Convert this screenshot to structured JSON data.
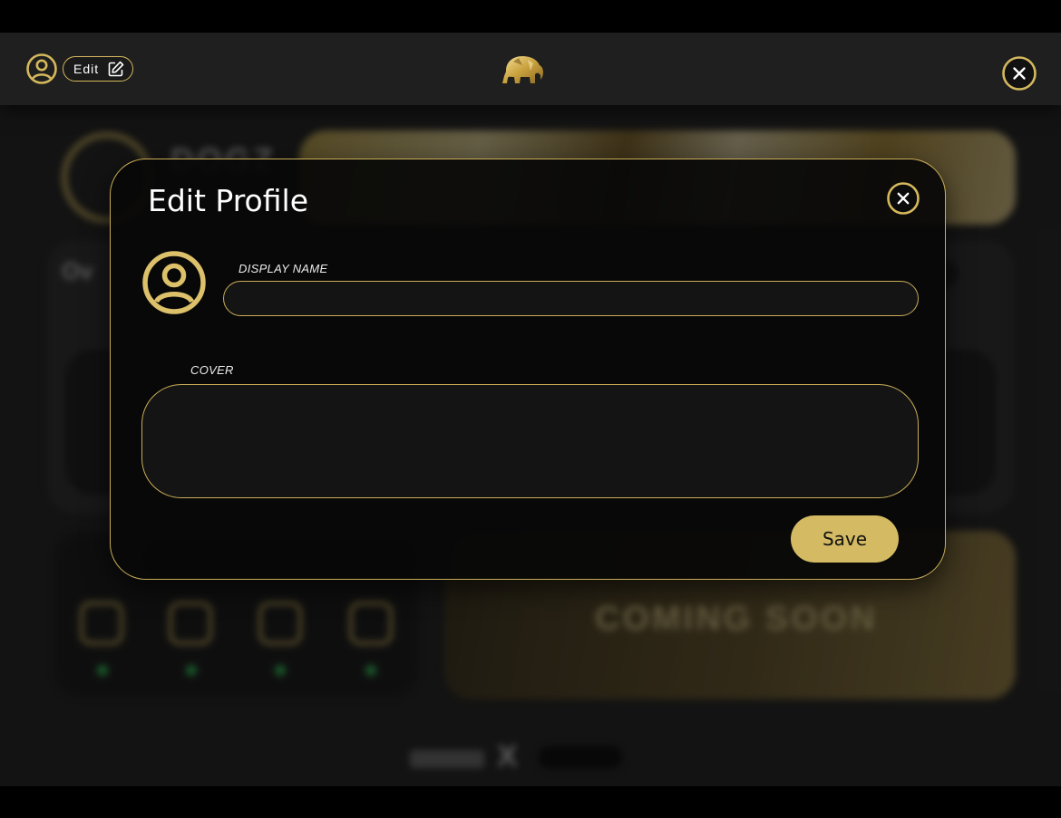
{
  "topbar": {
    "edit_label": "Edit"
  },
  "background": {
    "profile_name": "DOGZ",
    "overview_label": "Ov",
    "coming_soon": "COMING SOON",
    "footer_x": "X",
    "social_icons": [
      "x-icon",
      "discord-icon",
      "instagram-icon",
      "mail-icon"
    ]
  },
  "modal": {
    "title": "Edit Profile",
    "display_name_label": "DISPLAY NAME",
    "display_name_value": "",
    "cover_label": "COVER",
    "cover_value": "",
    "save_label": "Save"
  },
  "colors": {
    "accent_gold": "#d4b85c",
    "button_gold": "#d4ba63",
    "status_green": "#2fd35b",
    "background": "#1c1c1c"
  }
}
